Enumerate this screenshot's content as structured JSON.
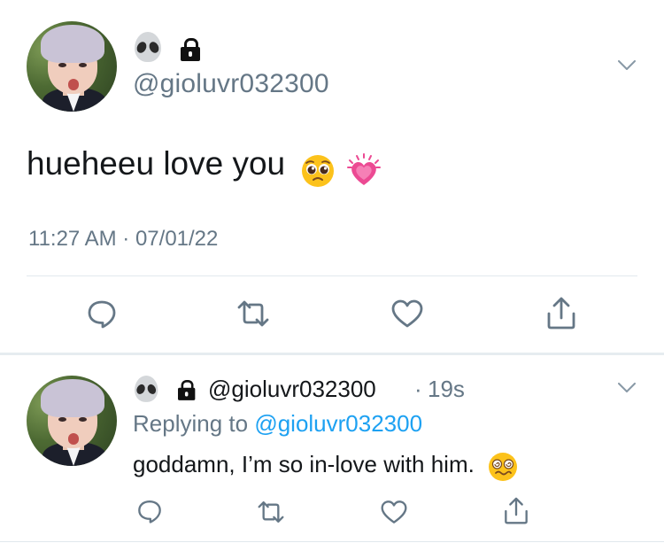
{
  "main_tweet": {
    "handle": "@gioluvr032300",
    "badge_icons": [
      "alien-emoji",
      "lock-icon"
    ],
    "text": "hueheeu love you",
    "emojis": [
      "pleading-face-emoji",
      "growing-heart-emoji"
    ],
    "timestamp": "11:27 AM · 07/01/22",
    "actions": [
      "reply-icon",
      "retweet-icon",
      "like-icon",
      "share-icon"
    ]
  },
  "reply": {
    "handle": "@gioluvr032300",
    "separator": "·",
    "time": "19s",
    "replying_prefix": "Replying to",
    "replying_handle": "@gioluvr032300",
    "text": "goddamn, I’m so in-love with him.",
    "emojis": [
      "woozy-face-emoji"
    ],
    "actions": [
      "reply-icon",
      "retweet-icon",
      "like-icon",
      "share-icon"
    ]
  },
  "colors": {
    "link": "#1da1f2",
    "secondary_text": "#657786",
    "primary_text": "#14171a",
    "divider": "#e1e8ed"
  }
}
